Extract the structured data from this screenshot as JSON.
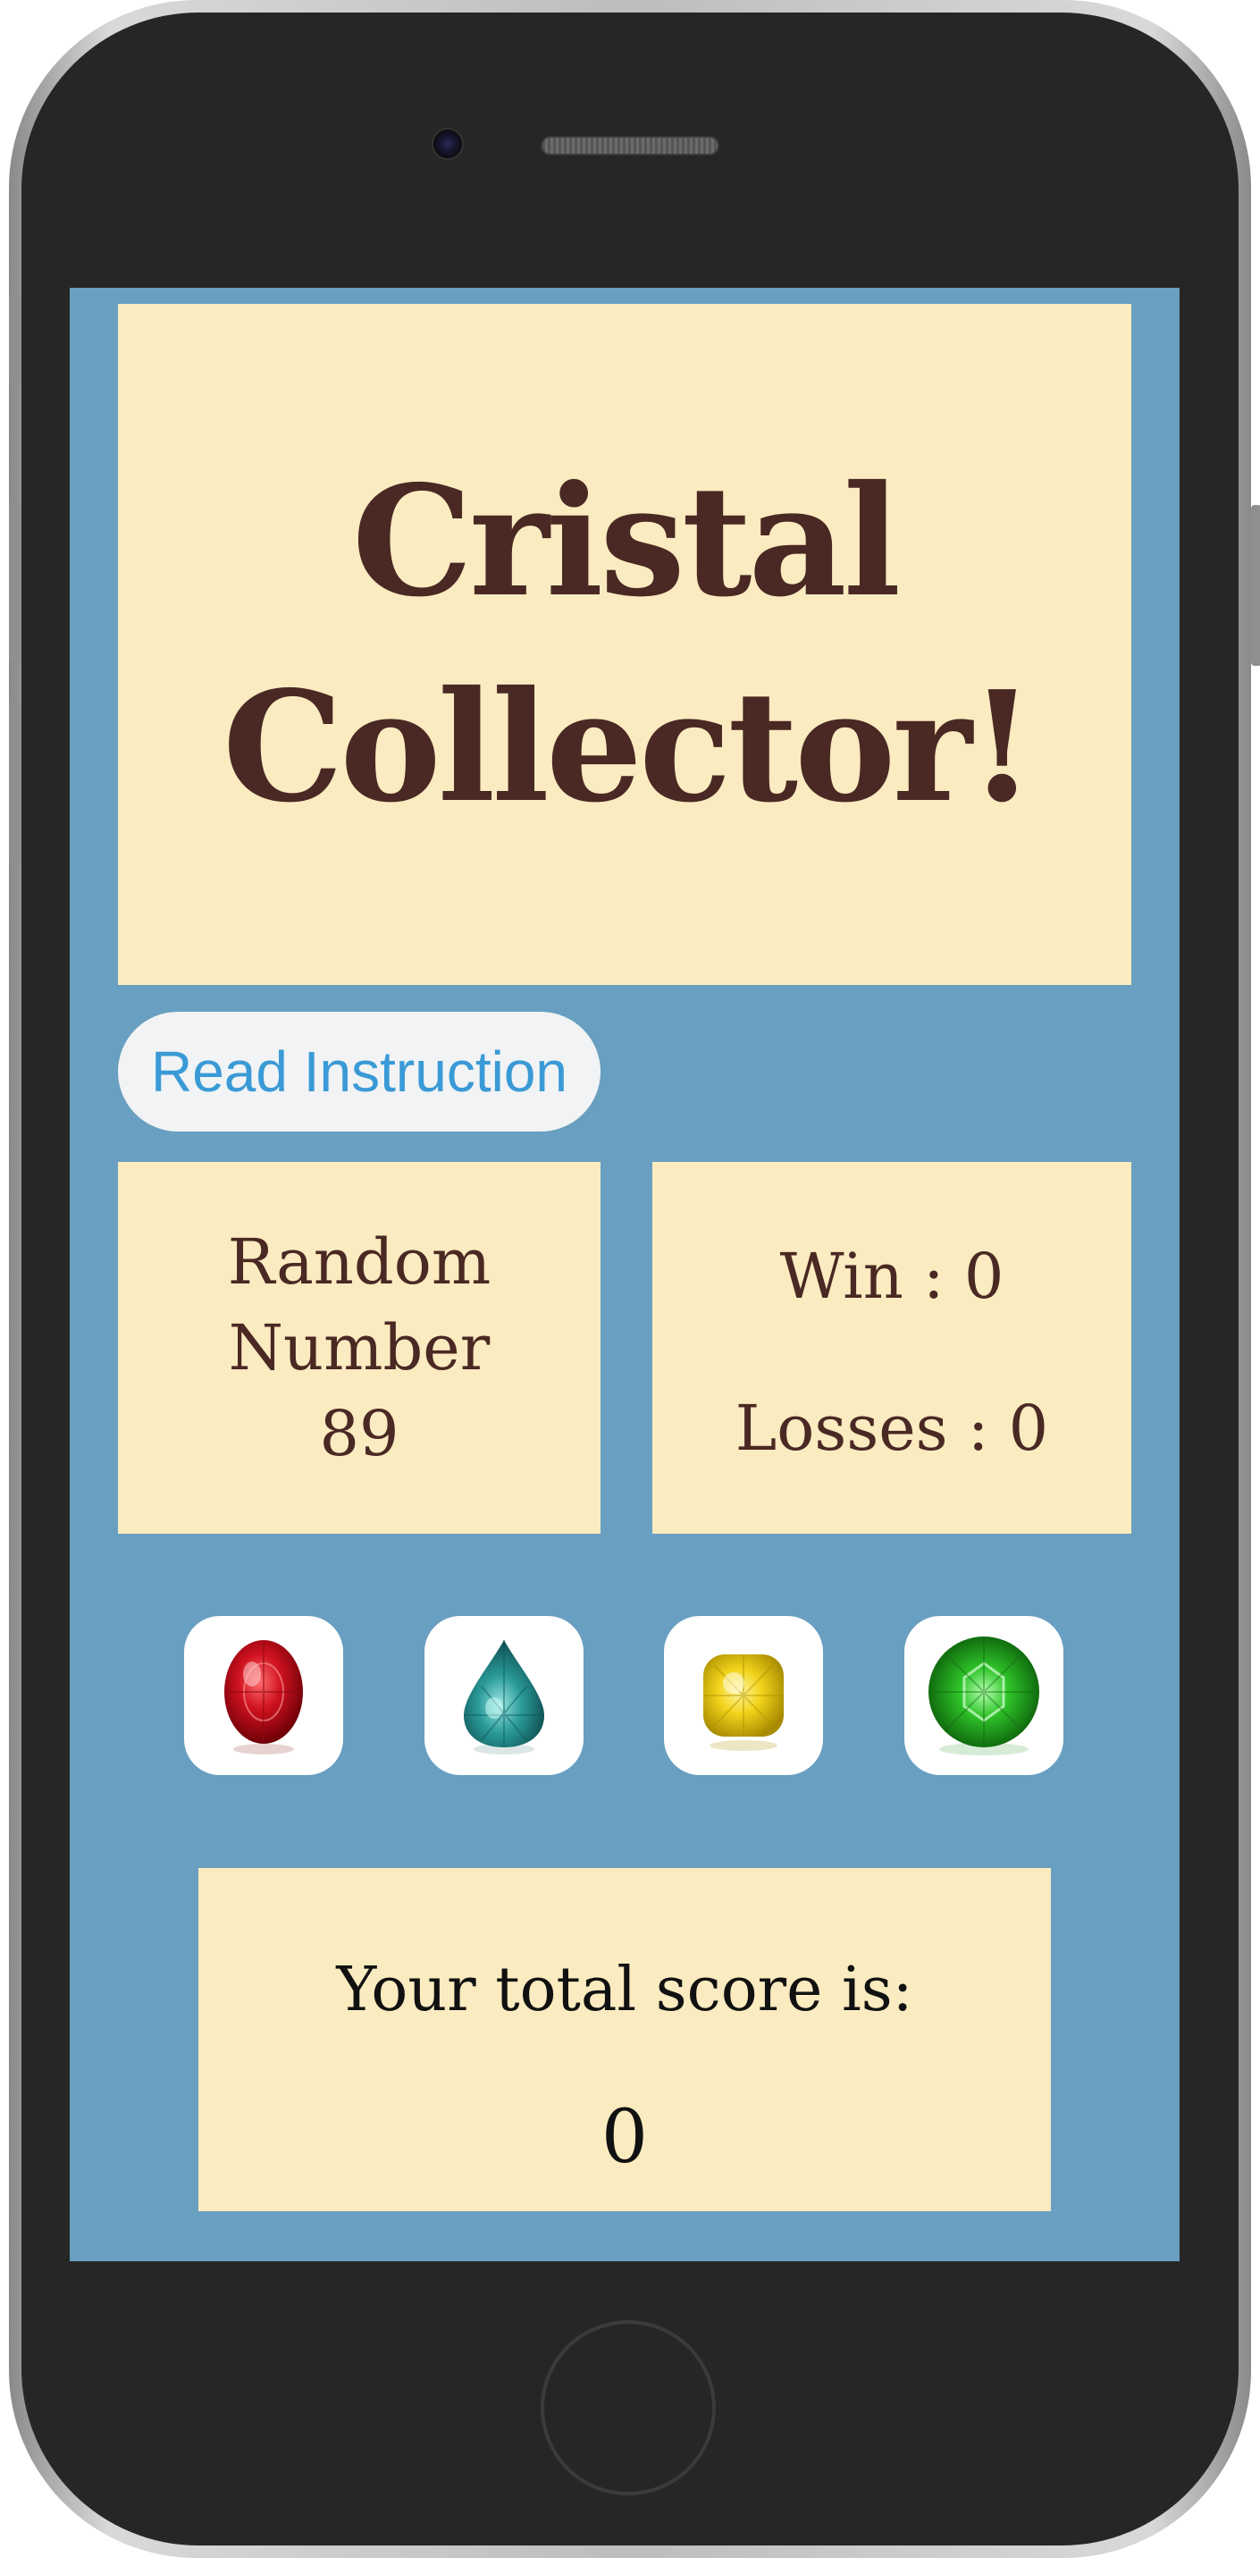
{
  "game": {
    "title": "Cristal Collector!",
    "instructions_button": "Read Instruction",
    "random_number_label": "Random Number",
    "random_number_value": "89",
    "wins_text": "Win : 0",
    "losses_text": "Losses : 0",
    "total_score_label": "Your total score is:",
    "total_score_value": "0"
  },
  "crystals": [
    {
      "icon": "ruby-gem-icon",
      "color": "#c4101d"
    },
    {
      "icon": "teal-teardrop-gem-icon",
      "color": "#2a9b9a"
    },
    {
      "icon": "yellow-cushion-gem-icon",
      "color": "#f2d41c"
    },
    {
      "icon": "green-round-gem-icon",
      "color": "#1fae1c"
    }
  ],
  "colors": {
    "screen_background": "#699fc0",
    "panel_background": "#faebc0",
    "title_text": "#4a2823",
    "button_text": "#3a9ad6"
  }
}
